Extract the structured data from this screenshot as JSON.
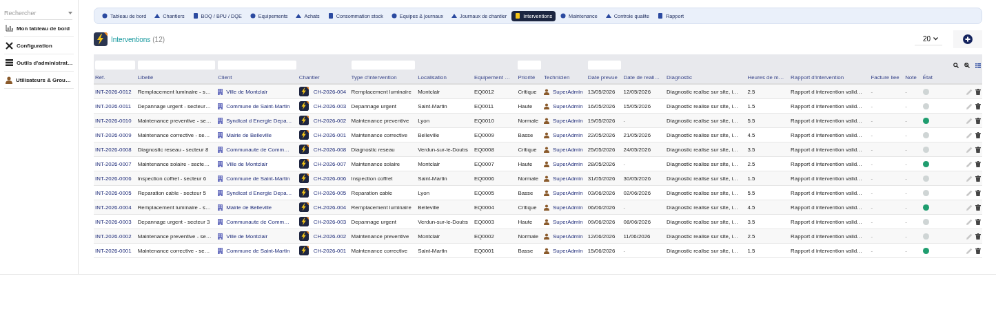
{
  "sidebar": {
    "search": {
      "placeholder": "Rechercher"
    },
    "items": [
      {
        "label": "Mon tableau de bord"
      },
      {
        "label": "Configuration"
      },
      {
        "label": "Outils d'administrat…"
      },
      {
        "label": "Utilisateurs & Grou…"
      }
    ]
  },
  "nav": {
    "tabs": [
      {
        "label": "Tableau de bord",
        "selected": false
      },
      {
        "label": "Chantiers",
        "selected": false
      },
      {
        "label": "BOQ / BPU / DQE",
        "selected": false
      },
      {
        "label": "Equipements",
        "selected": false
      },
      {
        "label": "Achats",
        "selected": false
      },
      {
        "label": "Consommation stock",
        "selected": false
      },
      {
        "label": "Equipes & journaux",
        "selected": false
      },
      {
        "label": "Journaux de chantier",
        "selected": false
      },
      {
        "label": "Interventions",
        "selected": true
      },
      {
        "label": "Maintenance",
        "selected": false
      },
      {
        "label": "Controle qualite",
        "selected": false
      },
      {
        "label": "Rapport",
        "selected": false
      }
    ]
  },
  "page": {
    "title": "Interventions",
    "count": "(12)",
    "page_size": "20"
  },
  "table": {
    "columns": [
      {
        "label": "Réf.",
        "kind": "ref",
        "filter": true
      },
      {
        "label": "Libellé",
        "kind": "text",
        "filter": true
      },
      {
        "label": "Client",
        "kind": "client",
        "filter": true
      },
      {
        "label": "Chantier",
        "kind": "site",
        "filter": false
      },
      {
        "label": "Type d'intervention",
        "kind": "text",
        "filter": true
      },
      {
        "label": "Localisation",
        "kind": "text",
        "filter": false
      },
      {
        "label": "Equipement …",
        "kind": "text",
        "filter": false
      },
      {
        "label": "Priorité",
        "kind": "text",
        "filter": true
      },
      {
        "label": "Technicien",
        "kind": "tech",
        "filter": false
      },
      {
        "label": "Date prevue",
        "kind": "text",
        "filter": true
      },
      {
        "label": "Date de reali…",
        "kind": "text",
        "filter": false
      },
      {
        "label": "Diagnostic",
        "kind": "text",
        "filter": false
      },
      {
        "label": "Heures de m…",
        "kind": "text",
        "filter": false
      },
      {
        "label": "Rapport d'intervention",
        "kind": "text",
        "filter": false
      },
      {
        "label": "Facture liee",
        "kind": "text",
        "filter": false
      },
      {
        "label": "Note",
        "kind": "text",
        "filter": false
      },
      {
        "label": "État",
        "kind": "status",
        "filter": false
      }
    ],
    "rows": [
      {
        "cells": [
          "INT-2026-0012",
          "Remplacement luminaire - s…",
          "Ville de Montclair",
          "CH-2026-004",
          "Remplacement luminaire",
          "Montclair",
          "EQ0012",
          "Critique",
          "SuperAdmin",
          "13/05/2026",
          "12/05/2026",
          "Diagnostic realise sur site, i…",
          "2.5",
          "Rapport d intervention valid…",
          "-",
          "-"
        ],
        "color": "#cfd5d5"
      },
      {
        "cells": [
          "INT-2026-0011",
          "Depannage urgent - secteur…",
          "Commune de Saint-Martin",
          "CH-2026-003",
          "Depannage urgent",
          "Saint-Martin",
          "EQ0011",
          "Haute",
          "SuperAdmin",
          "16/05/2026",
          "15/05/2026",
          "Diagnostic realise sur site, i…",
          "1.5",
          "Rapport d intervention valid…",
          "-",
          "-"
        ],
        "color": "#cfd5d5"
      },
      {
        "cells": [
          "INT-2026-0010",
          "Maintenance preventive - se…",
          "Syndicat d Energie Depa…",
          "CH-2026-002",
          "Maintenance preventive",
          "Lyon",
          "EQ0010",
          "Normale",
          "SuperAdmin",
          "19/05/2026",
          "-",
          "Diagnostic realise sur site, i…",
          "5.5",
          "Rapport d intervention valid…",
          "-",
          "-"
        ],
        "color": "#1f9d6f"
      },
      {
        "cells": [
          "INT-2026-0009",
          "Maintenance corrective - se…",
          "Mairie de Belleville",
          "CH-2026-001",
          "Maintenance corrective",
          "Belleville",
          "EQ0009",
          "Basse",
          "SuperAdmin",
          "22/05/2026",
          "21/05/2026",
          "Diagnostic realise sur site, i…",
          "4.5",
          "Rapport d intervention valid…",
          "-",
          "-"
        ],
        "color": "#cfd5d5"
      },
      {
        "cells": [
          "INT-2026-0008",
          "Diagnostic reseau - secteur 8",
          "Communaute de Comm…",
          "CH-2026-008",
          "Diagnostic reseau",
          "Verdun-sur-le-Doubs",
          "EQ0008",
          "Critique",
          "SuperAdmin",
          "25/05/2026",
          "24/05/2026",
          "Diagnostic realise sur site, i…",
          "3.5",
          "Rapport d intervention valid…",
          "-",
          "-"
        ],
        "color": "#cfd5d5"
      },
      {
        "cells": [
          "INT-2026-0007",
          "Maintenance solaire - secte…",
          "Ville de Montclair",
          "CH-2026-007",
          "Maintenance solaire",
          "Montclair",
          "EQ0007",
          "Haute",
          "SuperAdmin",
          "28/05/2026",
          "-",
          "Diagnostic realise sur site, i…",
          "2.5",
          "Rapport d intervention valid…",
          "-",
          "-"
        ],
        "color": "#1f9d6f"
      },
      {
        "cells": [
          "INT-2026-0006",
          "Inspection coffret - secteur 6",
          "Commune de Saint-Martin",
          "CH-2026-006",
          "Inspection coffret",
          "Saint-Martin",
          "EQ0006",
          "Normale",
          "SuperAdmin",
          "31/05/2026",
          "30/05/2026",
          "Diagnostic realise sur site, i…",
          "1.5",
          "Rapport d intervention valid…",
          "-",
          "-"
        ],
        "color": "#cfd5d5"
      },
      {
        "cells": [
          "INT-2026-0005",
          "Reparation cable - secteur 5",
          "Syndicat d Energie Depa…",
          "CH-2026-005",
          "Reparation cable",
          "Lyon",
          "EQ0005",
          "Basse",
          "SuperAdmin",
          "03/06/2026",
          "02/06/2026",
          "Diagnostic realise sur site, i…",
          "5.5",
          "Rapport d intervention valid…",
          "-",
          "-"
        ],
        "color": "#cfd5d5"
      },
      {
        "cells": [
          "INT-2026-0004",
          "Remplacement luminaire - s…",
          "Mairie de Belleville",
          "CH-2026-004",
          "Remplacement luminaire",
          "Belleville",
          "EQ0004",
          "Critique",
          "SuperAdmin",
          "06/06/2026",
          "-",
          "Diagnostic realise sur site, i…",
          "4.5",
          "Rapport d intervention valid…",
          "-",
          "-"
        ],
        "color": "#1f9d6f"
      },
      {
        "cells": [
          "INT-2026-0003",
          "Depannage urgent - secteur 3",
          "Communaute de Comm…",
          "CH-2026-003",
          "Depannage urgent",
          "Verdun-sur-le-Doubs",
          "EQ0003",
          "Haute",
          "SuperAdmin",
          "09/06/2026",
          "08/06/2026",
          "Diagnostic realise sur site, i…",
          "3.5",
          "Rapport d intervention valid…",
          "-",
          "-"
        ],
        "color": "#cfd5d5"
      },
      {
        "cells": [
          "INT-2026-0002",
          "Maintenance preventive - se…",
          "Ville de Montclair",
          "CH-2026-002",
          "Maintenance preventive",
          "Montclair",
          "EQ0002",
          "Normale",
          "SuperAdmin",
          "12/06/2026",
          "11/06/2026",
          "Diagnostic realise sur site, i…",
          "2.5",
          "Rapport d intervention valid…",
          "-",
          "-"
        ],
        "color": "#cfd5d5"
      },
      {
        "cells": [
          "INT-2026-0001",
          "Maintenance corrective - se…",
          "Commune de Saint-Martin",
          "CH-2026-001",
          "Maintenance corrective",
          "Saint-Martin",
          "EQ0001",
          "Basse",
          "SuperAdmin",
          "15/06/2026",
          "-",
          "Diagnostic realise sur site, i…",
          "1.5",
          "Rapport d intervention valid…",
          "-",
          "-"
        ],
        "color": "#1f9d6f"
      }
    ]
  }
}
